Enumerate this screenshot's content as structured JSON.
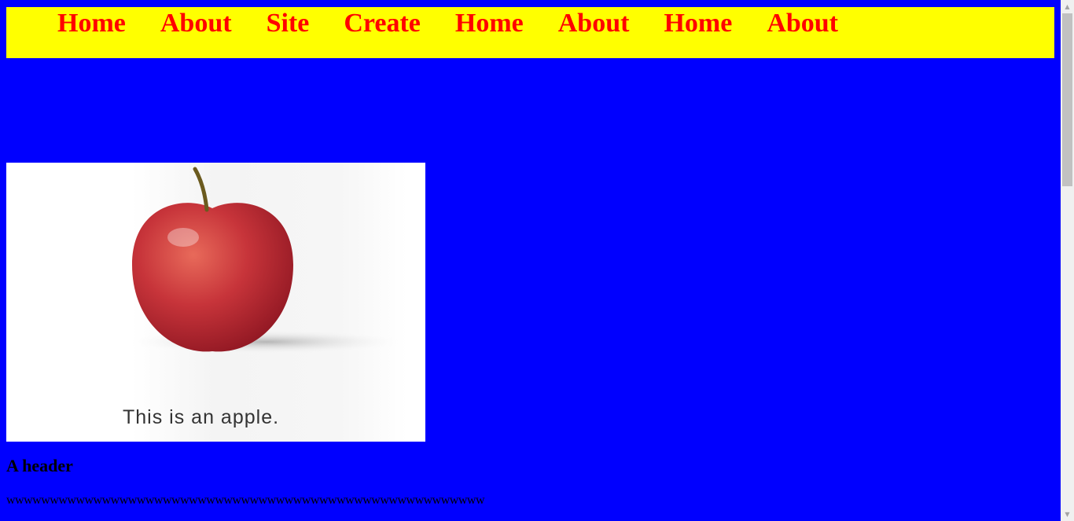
{
  "nav": {
    "items": [
      "Home",
      "About",
      "Site",
      "Create",
      "Home",
      "About",
      "Home",
      "About"
    ]
  },
  "image": {
    "caption": "This is an apple."
  },
  "content": {
    "heading": "A header",
    "text": "wwwwwwwwwwwwwwwwwwwwwwwwwwwwwwwwwwwwwwwwwwwwwwwwwwwwwww"
  },
  "icons": {
    "scroll_up": "scroll-up-arrow-icon",
    "scroll_down": "scroll-down-arrow-icon"
  },
  "colors": {
    "page_background": "#0000ff",
    "navbar_background": "#ffff00",
    "nav_text": "#ff0000"
  }
}
